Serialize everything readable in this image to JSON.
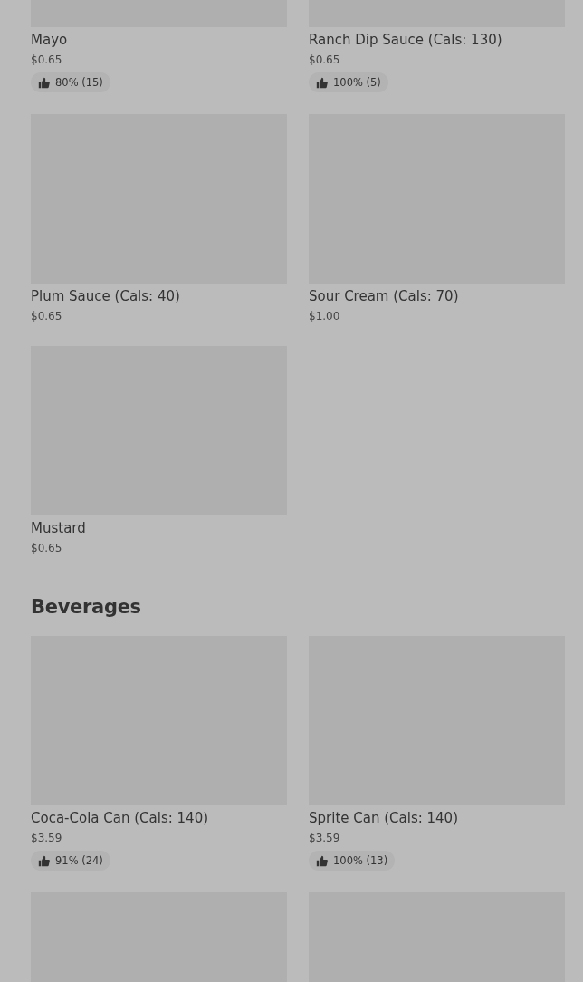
{
  "sections": [
    {
      "items": [
        {
          "kind": "image",
          "name": "Mayo",
          "price": "$0.65",
          "rating": "80% (15)"
        },
        {
          "kind": "image",
          "name": "Ranch Dip Sauce (Cals: 130)",
          "price": "$0.65",
          "rating": "100% (5)"
        },
        {
          "kind": "image",
          "name": "Plum Sauce (Cals: 40)",
          "price": "$0.65"
        },
        {
          "kind": "image",
          "name": "Sour Cream (Cals: 70)",
          "price": "$1.00"
        },
        {
          "kind": "image",
          "name": "Mustard",
          "price": "$0.65"
        }
      ]
    },
    {
      "title": "Beverages",
      "items": [
        {
          "kind": "image",
          "name": "Coca-Cola Can (Cals: 140)",
          "price": "$3.59",
          "rating": "91% (24)"
        },
        {
          "kind": "image",
          "name": "Sprite Can (Cals: 140)",
          "price": "$3.59",
          "rating": "100% (13)"
        },
        {
          "kind": "image"
        },
        {
          "kind": "image"
        }
      ]
    }
  ]
}
